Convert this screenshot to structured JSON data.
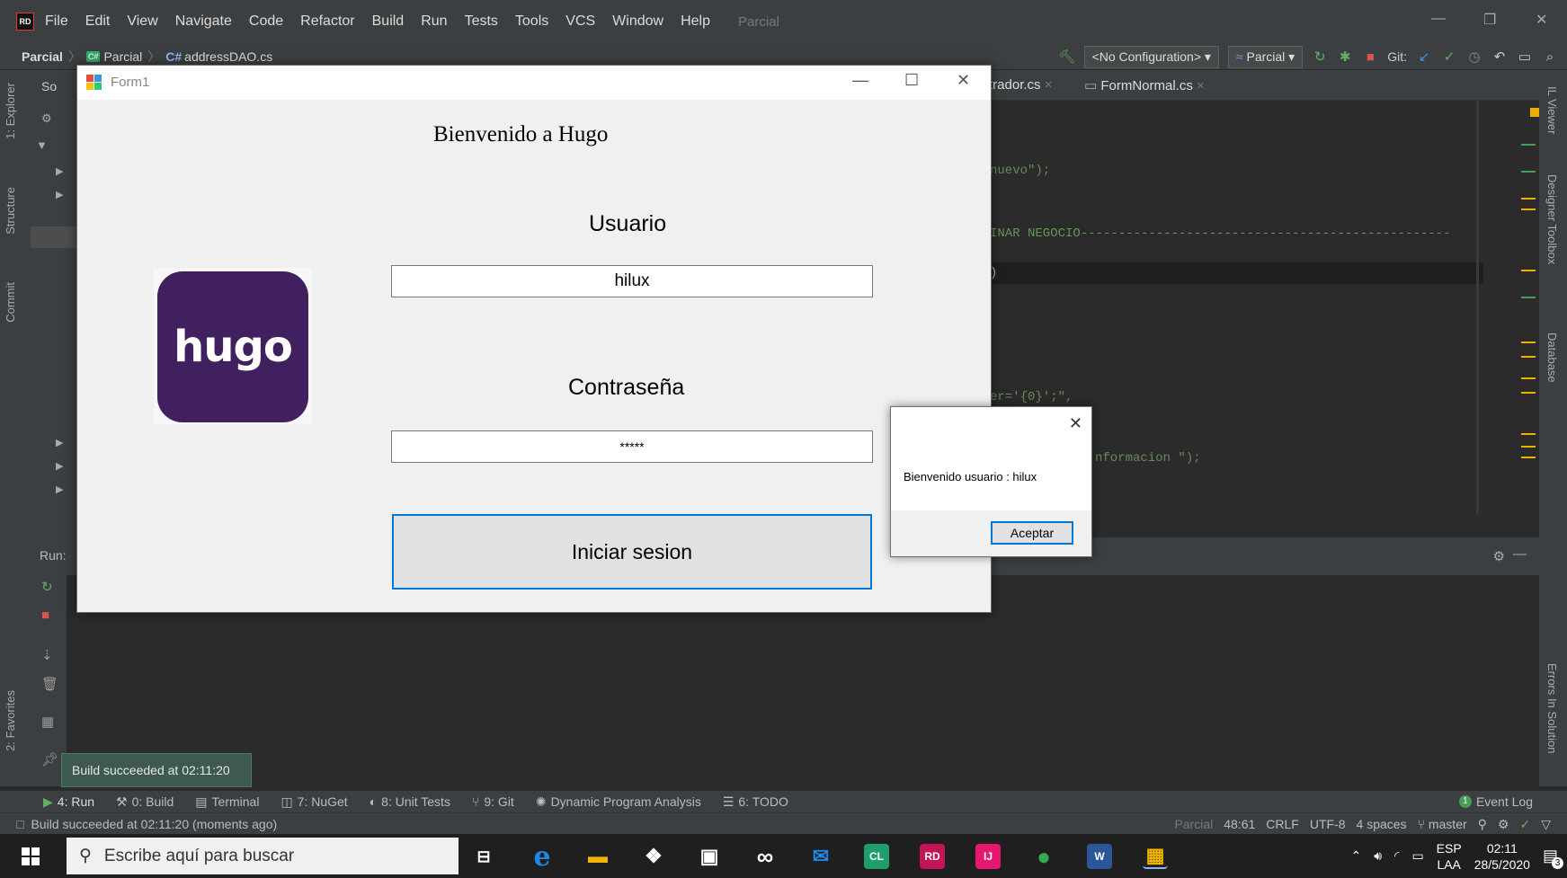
{
  "ide": {
    "logo": "RD",
    "menu": [
      "File",
      "Edit",
      "View",
      "Navigate",
      "Code",
      "Refactor",
      "Build",
      "Run",
      "Tests",
      "Tools",
      "VCS",
      "Window",
      "Help"
    ],
    "project_title": "Parcial",
    "breadcrumb": {
      "root": "Parcial",
      "project": "Parcial",
      "file": "addressDAO.cs"
    },
    "run_config": "<No Configuration>",
    "target": "Parcial",
    "git_label": "Git:",
    "editor_tabs": [
      "trador.cs",
      "FormNormal.cs"
    ],
    "explorer_header": "So",
    "code_lines": [
      {
        "text": "nuevo\");",
        "kind": "str"
      },
      {
        "text": "INAR NEGOCIO-------------------------------------------------",
        "kind": "cmt"
      },
      {
        "text": ")",
        "kind": "plain"
      },
      {
        "text": "er='{0}';\",",
        "kind": "str"
      },
      {
        "text": "nformacion \");",
        "kind": "str"
      }
    ],
    "left_tabs": [
      "1: Explorer",
      "Structure",
      "Commit",
      "2: Favorites"
    ],
    "right_tabs": [
      "IL Viewer",
      "Designer Toolbox",
      "Database",
      "Errors In Solution"
    ],
    "run_label": "Run:",
    "build_tooltip": "Build succeeded at 02:11:20",
    "bottom_tabs": [
      {
        "label": "4: Run",
        "icon": "play-icon"
      },
      {
        "label": "0: Build",
        "icon": "hammer-icon"
      },
      {
        "label": "Terminal",
        "icon": "terminal-icon"
      },
      {
        "label": "7: NuGet",
        "icon": "nuget-icon"
      },
      {
        "label": "8: Unit Tests",
        "icon": "unit-tests-icon"
      },
      {
        "label": "9: Git",
        "icon": "git-icon"
      },
      {
        "label": "Dynamic Program Analysis",
        "icon": "dpa-icon"
      },
      {
        "label": "6: TODO",
        "icon": "todo-icon"
      }
    ],
    "event_log": "Event Log",
    "event_log_count": "1",
    "status_message": "Build succeeded at 02:11:20 (moments ago)",
    "status_right": {
      "project": "Parcial",
      "position": "48:61",
      "line_sep": "CRLF",
      "encoding": "UTF-8",
      "indent": "4 spaces",
      "branch": "master"
    }
  },
  "form1": {
    "title": "Form1",
    "welcome": "Bienvenido a Hugo",
    "user_label": "Usuario",
    "user_value": "hilux",
    "pass_label": "Contraseña",
    "pass_value": "*****",
    "login_button": "Iniciar sesion",
    "logo_text": "hugo",
    "logo_color": "#40205f"
  },
  "msgbox": {
    "text": "Bienvenido usuario : hilux",
    "ok_button": "Aceptar"
  },
  "taskbar": {
    "search_placeholder": "Escribe aquí para buscar",
    "apps": [
      {
        "name": "task-view-icon",
        "label": "⊟",
        "color": "#1f1f1f"
      },
      {
        "name": "edge-icon",
        "label": "e",
        "color": "#1f1f1f"
      },
      {
        "name": "file-explorer-icon",
        "label": "▬",
        "color": "#1f1f1f"
      },
      {
        "name": "dropbox-icon",
        "label": "❖",
        "color": "#1f1f1f"
      },
      {
        "name": "store-icon",
        "label": "▣",
        "color": "#1f1f1f"
      },
      {
        "name": "arduino-icon",
        "label": "∞",
        "color": "#1f1f1f"
      },
      {
        "name": "mail-icon",
        "label": "✉",
        "color": "#1f1f1f"
      },
      {
        "name": "clion-icon",
        "label": "CL",
        "color": "#1e9e6a"
      },
      {
        "name": "rider-icon",
        "label": "RD",
        "color": "#c21456"
      },
      {
        "name": "intellij-icon",
        "label": "IJ",
        "color": "#e5176f"
      },
      {
        "name": "chrome-icon",
        "label": "●",
        "color": "#1f1f1f"
      },
      {
        "name": "word-icon",
        "label": "W",
        "color": "#2b579a"
      },
      {
        "name": "winforms-app-icon",
        "label": "▦",
        "color": "#1f1f1f"
      }
    ],
    "language": "ESP",
    "layout": "LAA",
    "time": "02:11",
    "date": "28/5/2020",
    "notifications": "3"
  },
  "colors": {
    "ide_bg": "#2b2b2b",
    "ide_panel": "#3c3f41",
    "accent_blue": "#0078d7",
    "build_ok": "#3e5a4e"
  }
}
